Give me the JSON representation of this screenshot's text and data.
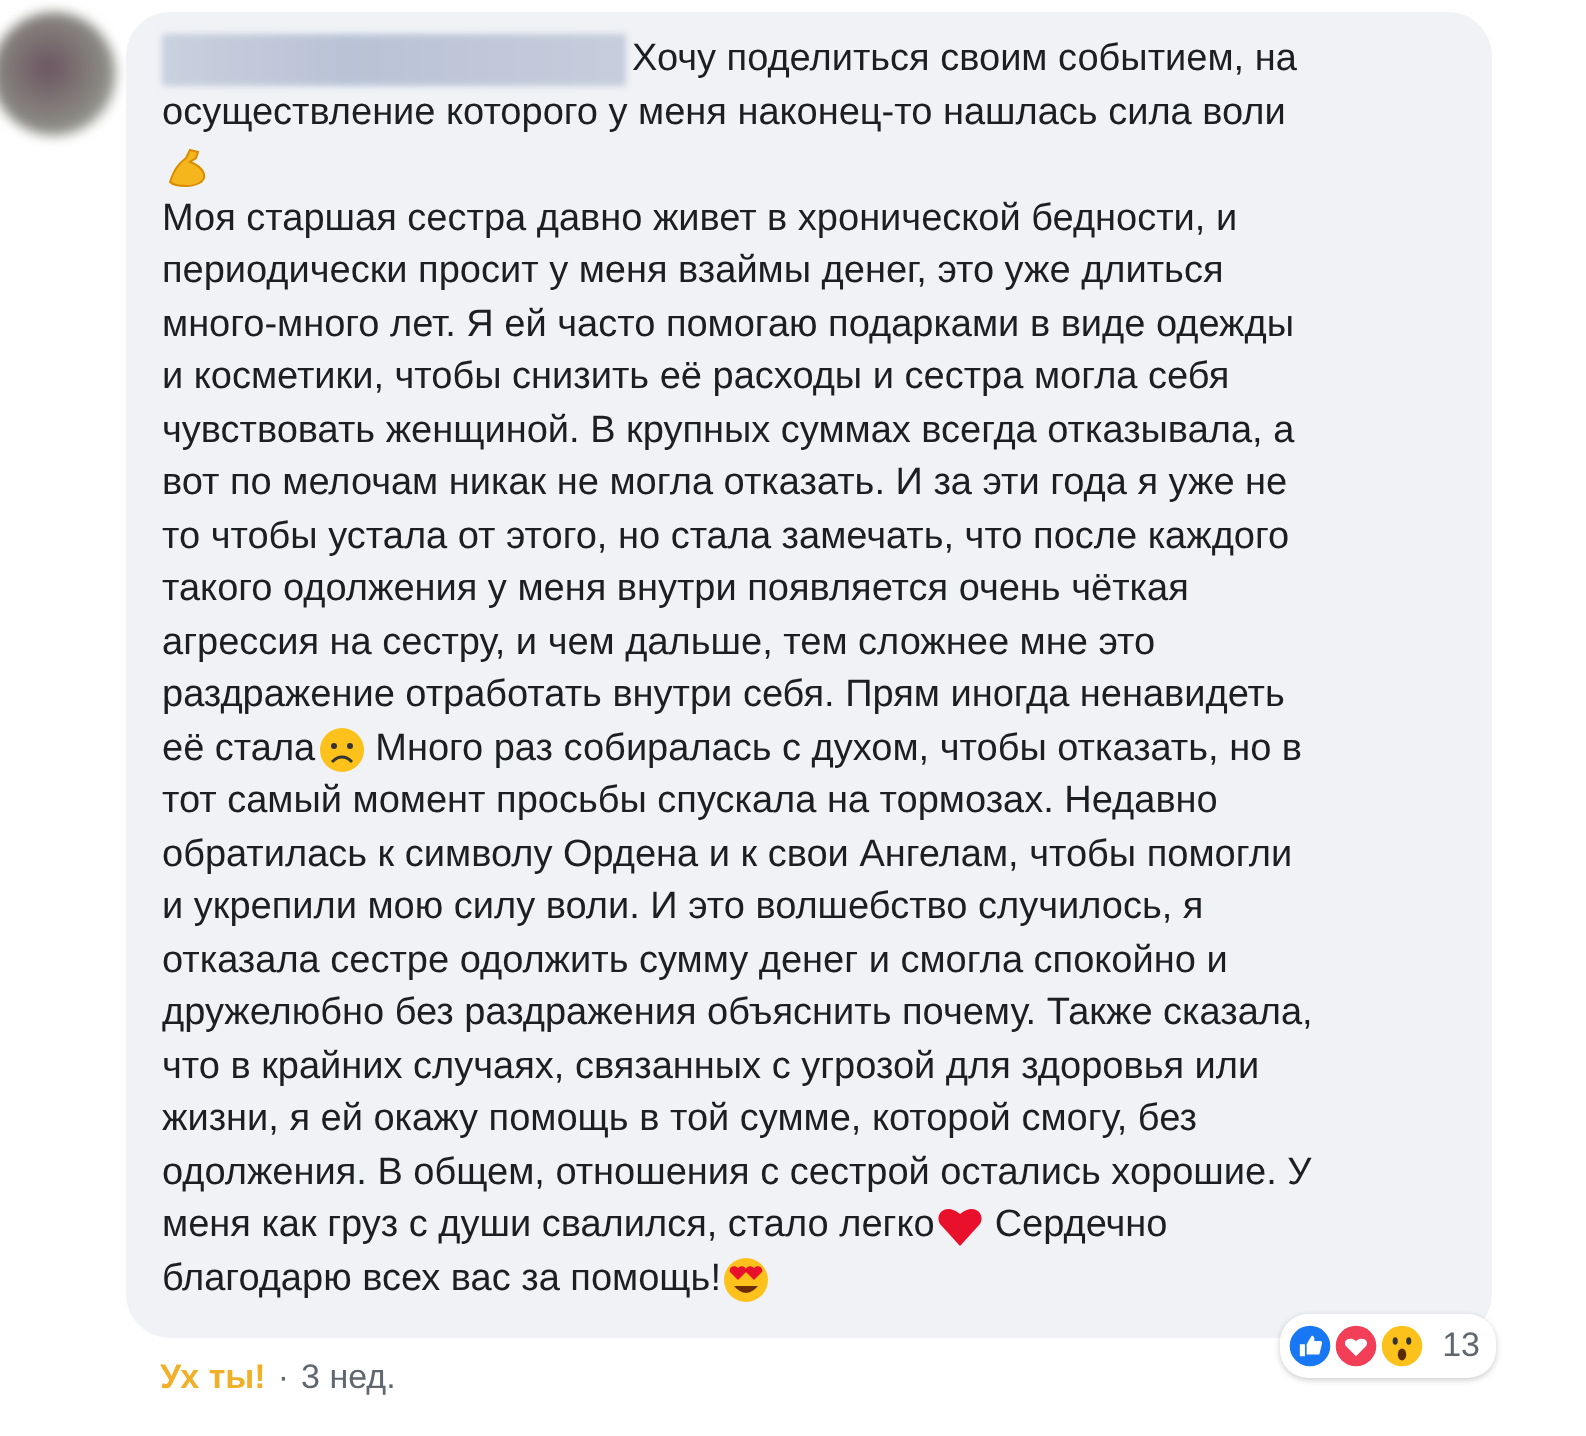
{
  "comment": {
    "lines": [
      [
        {
          "kind": "text",
          "text": "Хочу поделиться своим событием, на"
        }
      ],
      [
        {
          "kind": "text",
          "text": "осуществление которого у меня наконец-то нашлась сила воли"
        }
      ],
      [
        {
          "kind": "muscle"
        }
      ],
      [
        {
          "kind": "text",
          "text": "Моя старшая сестра давно живет в хронической бедности, и"
        }
      ],
      [
        {
          "kind": "text",
          "text": "периодически просит у меня взаймы денег, это уже длиться"
        }
      ],
      [
        {
          "kind": "text",
          "text": "много-много лет. Я ей часто помогаю подарками в виде одежды"
        }
      ],
      [
        {
          "kind": "text",
          "text": "и косметики, чтобы снизить её расходы и сестра могла себя"
        }
      ],
      [
        {
          "kind": "text",
          "text": "чувствовать женщиной. В крупных суммах всегда отказывала, а"
        }
      ],
      [
        {
          "kind": "text",
          "text": "вот по мелочам никак не могла отказать. И за эти года я уже не"
        }
      ],
      [
        {
          "kind": "text",
          "text": "то чтобы устала от этого, но стала замечать, что после каждого"
        }
      ],
      [
        {
          "kind": "text",
          "text": "такого одолжения у меня внутри появляется очень чёткая"
        }
      ],
      [
        {
          "kind": "text",
          "text": "агрессия на сестру, и чем дальше, тем сложнее мне это"
        }
      ],
      [
        {
          "kind": "text",
          "text": "раздражение отработать внутри себя. Прям иногда ненавидеть"
        }
      ],
      [
        {
          "kind": "text",
          "text": "её стала"
        },
        {
          "kind": "worried"
        },
        {
          "kind": "text",
          "text": "Много раз собиралась с духом, чтобы отказать, но в"
        }
      ],
      [
        {
          "kind": "text",
          "text": "тот самый момент просьбы спускала на тормозах. Недавно"
        }
      ],
      [
        {
          "kind": "text",
          "text": "обратилась к символу Ордена и к свои Ангелам, чтобы помогли"
        }
      ],
      [
        {
          "kind": "text",
          "text": "и укрепили мою силу воли. И это волшебство случилось, я"
        }
      ],
      [
        {
          "kind": "text",
          "text": "отказала сестре одолжить сумму денег и смогла спокойно и"
        }
      ],
      [
        {
          "kind": "text",
          "text": "дружелюбно без раздражения объяснить почему. Также сказала,"
        }
      ],
      [
        {
          "kind": "text",
          "text": "что в крайних случаях, связанных с угрозой для здоровья или"
        }
      ],
      [
        {
          "kind": "text",
          "text": "жизни, я ей окажу помощь в той сумме, которой смогу, без"
        }
      ],
      [
        {
          "kind": "text",
          "text": "одолжения. В общем, отношения с сестрой остались хорошие. У"
        }
      ],
      [
        {
          "kind": "text",
          "text": "меня как груз с души свалился, стало легко"
        },
        {
          "kind": "heart"
        },
        {
          "kind": "text",
          "text": "Сердечно"
        }
      ],
      [
        {
          "kind": "text",
          "text": "благодарю всех вас за помощь!"
        },
        {
          "kind": "love-eyes"
        }
      ]
    ],
    "reactions": {
      "count": "13"
    },
    "footer": {
      "reaction": "Ух ты!",
      "separator": "·",
      "time": "3 нед."
    }
  }
}
